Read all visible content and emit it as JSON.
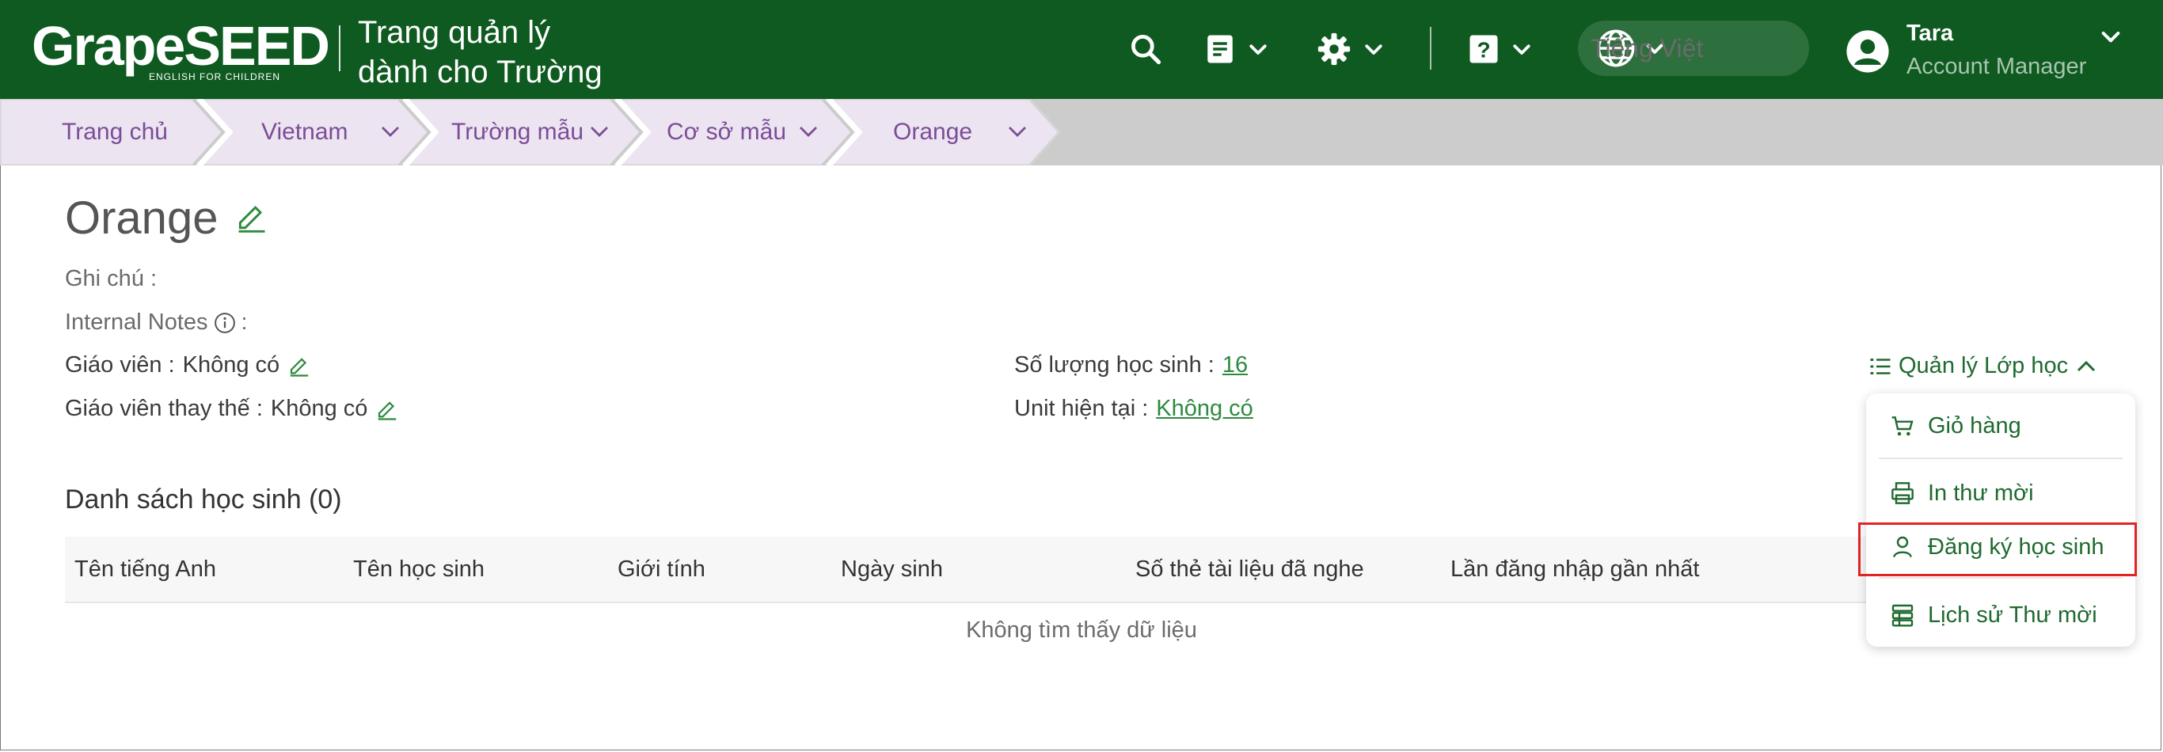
{
  "header": {
    "logo_text": "GrapeSEED",
    "logo_tagline": "ENGLISH FOR CHILDREN",
    "app_title_line1": "Trang quản lý",
    "app_title_line2": "dành cho Trường",
    "language": "Tiếng Việt",
    "user_name": "Tara",
    "user_role": "Account Manager",
    "icons": [
      "search-icon",
      "document-icon",
      "gear-icon",
      "help-icon",
      "globe-icon",
      "user-avatar-icon"
    ]
  },
  "breadcrumb": [
    "Trang chủ",
    "Vietnam",
    "Trường mẫu",
    "Cơ sở mẫu",
    "Orange"
  ],
  "class": {
    "title": "Orange",
    "note_label": "Ghi chú :",
    "internal_notes_label": "Internal Notes",
    "teacher_label": "Giáo viên :",
    "teacher_value": "Không có",
    "substitute_label": "Giáo viên thay thế :",
    "substitute_value": "Không có",
    "student_count_label": "Số lượng học sinh :",
    "student_count_value": "16",
    "current_unit_label": "Unit hiện tại :",
    "current_unit_value": "Không có"
  },
  "manage_menu": {
    "toggle_label": "Quản lý Lớp học",
    "items": [
      "Giỏ hàng",
      "In thư mời",
      "Đăng ký học sinh",
      "Lịch sử Thư mời"
    ]
  },
  "students": {
    "section_title": "Danh sách học sinh (0)",
    "columns": [
      "Tên tiếng Anh",
      "Tên học sinh",
      "Giới tính",
      "Ngày sinh",
      "Số thẻ tài liệu đã nghe",
      "Lần đăng nhập gần nhất"
    ],
    "empty_text": "Không tìm thấy dữ liệu"
  },
  "colors": {
    "header_bg": "#0f5a21",
    "accent_green": "#2e8a3f",
    "breadcrumb_text": "#7b4d96",
    "highlight_border": "#e02424"
  }
}
